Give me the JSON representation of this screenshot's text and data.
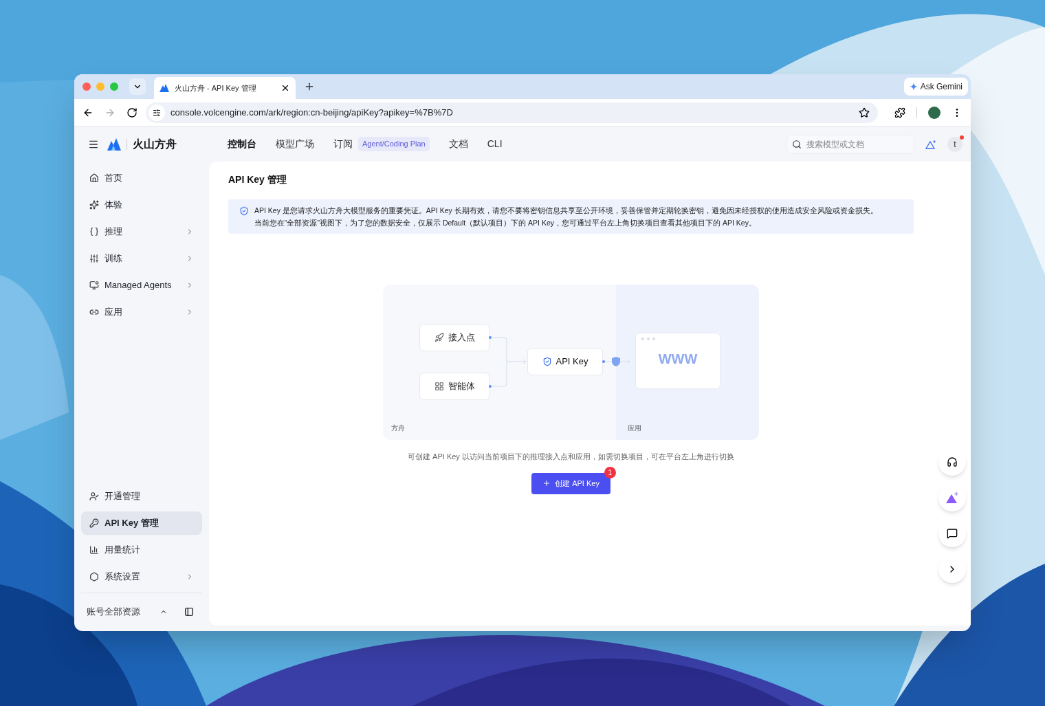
{
  "browser": {
    "tab_title": "火山方舟 - API Key 管理",
    "url": "console.volcengine.com/ark/region:cn-beijing/apiKey?apikey=%7B%7D",
    "gemini": "Ask Gemini"
  },
  "header": {
    "brand": "火山方舟",
    "nav": [
      {
        "label": "控制台",
        "selected": true
      },
      {
        "label": "模型广场",
        "selected": false
      },
      {
        "label": "订阅",
        "selected": false,
        "badge": "Agent/Coding Plan"
      },
      {
        "label": "文档",
        "selected": false
      },
      {
        "label": "CLI",
        "selected": false
      }
    ],
    "search": {
      "placeholder": "搜索模型或文档"
    },
    "avatar": "t",
    "notification": true
  },
  "sidebar": {
    "items": [
      {
        "label": "首页",
        "expandable": false,
        "selected": false
      },
      {
        "label": "体验",
        "expandable": false,
        "selected": false
      },
      {
        "label": "推理",
        "expandable": true,
        "selected": false
      },
      {
        "label": "训练",
        "expandable": true,
        "selected": false
      },
      {
        "label": "Managed Agents",
        "expandable": true,
        "selected": false
      },
      {
        "label": "应用",
        "expandable": true,
        "selected": false
      }
    ],
    "bottom_items": [
      {
        "label": "开通管理",
        "expandable": false,
        "selected": false
      },
      {
        "label": "API Key 管理",
        "expandable": false,
        "selected": true
      },
      {
        "label": "用量统计",
        "expandable": false,
        "selected": false
      },
      {
        "label": "系统设置",
        "expandable": true,
        "selected": false
      }
    ],
    "footer": "账号全部资源"
  },
  "page": {
    "title": "API Key 管理",
    "notice": [
      "API Key 是您请求火山方舟大模型服务的重要凭证。API Key 长期有效，请您不要将密钥信息共享至公开环境，妥善保管并定期轮换密钥，避免因未经授权的使用造成安全风险或资金损失。",
      "当前您在“全部资源”视图下，为了您的数据安全，仅展示 Default（默认项目）下的 API Key，您可通过平台左上角切换项目查看其他项目下的 API Key。"
    ],
    "diagram": {
      "sources": [
        "接入点",
        "智能体"
      ],
      "key": "API Key",
      "app": "WWW",
      "left_label": "方舟",
      "right_label": "应用"
    },
    "caption": "可创建 API Key 以访问当前项目下的推理接入点和应用，如需切换项目，可在平台左上角进行切换",
    "create_button": "创建 API Key",
    "create_badge": "1"
  }
}
